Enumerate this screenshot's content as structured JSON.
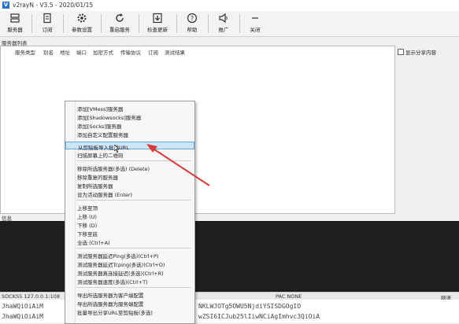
{
  "window": {
    "title": "v2rayN - V3.5 - 2020/01/15",
    "icon": "V"
  },
  "toolbar": {
    "buttons": [
      {
        "label": "服务器",
        "icon": "server-icon"
      },
      {
        "label": "订阅",
        "icon": "subscription-icon"
      },
      {
        "label": "参数设置",
        "icon": "gear-icon"
      },
      {
        "label": "重启服务",
        "icon": "restart-icon"
      },
      {
        "label": "检查更新",
        "icon": "download-icon"
      },
      {
        "label": "帮助",
        "icon": "help-icon"
      },
      {
        "label": "推广",
        "icon": "speaker-icon"
      },
      {
        "label": "关闭",
        "icon": "close-icon"
      }
    ]
  },
  "server_list": {
    "label": "服务器列表",
    "columns": [
      "服务类型",
      "别名",
      "地址",
      "端口",
      "加密方式",
      "传输协议",
      "订阅",
      "测试结果"
    ],
    "share_checkbox": "显示分享内容"
  },
  "info": {
    "label": "信息"
  },
  "status_bar": {
    "socks": "SOCKS5  127.0.0.1:108",
    "pac": "PAC  NONE",
    "right": "网速"
  },
  "bottom_text": {
    "line1_left": "JhaWQiOiAiM",
    "line1_right": "NKLWJOTg5OWU5NjdiYSISDGOgIO",
    "line2_left": "JhaWQiOiAiM",
    "line2_right": "wZSI6ICJub25lIiwNCiAgImhvc3QiOiA"
  },
  "context_menu": {
    "items": [
      {
        "label": "添加[VMess]服务器"
      },
      {
        "label": "添加[Shadowsocks]服务器"
      },
      {
        "label": "添加[Socks]服务器"
      },
      {
        "label": "添加自定义配置服务器"
      },
      {
        "label": "从剪贴板导入批量URL"
      },
      {
        "label": "扫描屏幕上的二维码"
      },
      {
        "label": "移除所选服务器(多选)    (Delete)"
      },
      {
        "label": "移除重复的服务器"
      },
      {
        "label": "复制所选服务器"
      },
      {
        "label": "设为活动服务器    (Enter)"
      },
      {
        "label": "上移至顶"
      },
      {
        "label": "上移        (U)"
      },
      {
        "label": "下移        (D)"
      },
      {
        "label": "下移至底"
      },
      {
        "label": "全选        (Ctrl+A)"
      },
      {
        "label": "测试服务器延迟Ping(多选)(Ctrl+P)"
      },
      {
        "label": "测试服务器延迟Tcping(多选)(Ctrl+O)"
      },
      {
        "label": "测试服务器真连接延迟(多选)(Ctrl+R)"
      },
      {
        "label": "测试服务器速度(多选)(Ctrl+T)"
      },
      {
        "label": "导出所选服务器为客户端配置"
      },
      {
        "label": "导出所选服务器为服务端配置"
      },
      {
        "label": "批量导出分享URL至剪贴板(多选)"
      }
    ],
    "highlighted_index": 4
  },
  "colors": {
    "highlight": "#cce4f7",
    "arrow": "#d93a3a",
    "log_bg": "#1e1e1e"
  }
}
